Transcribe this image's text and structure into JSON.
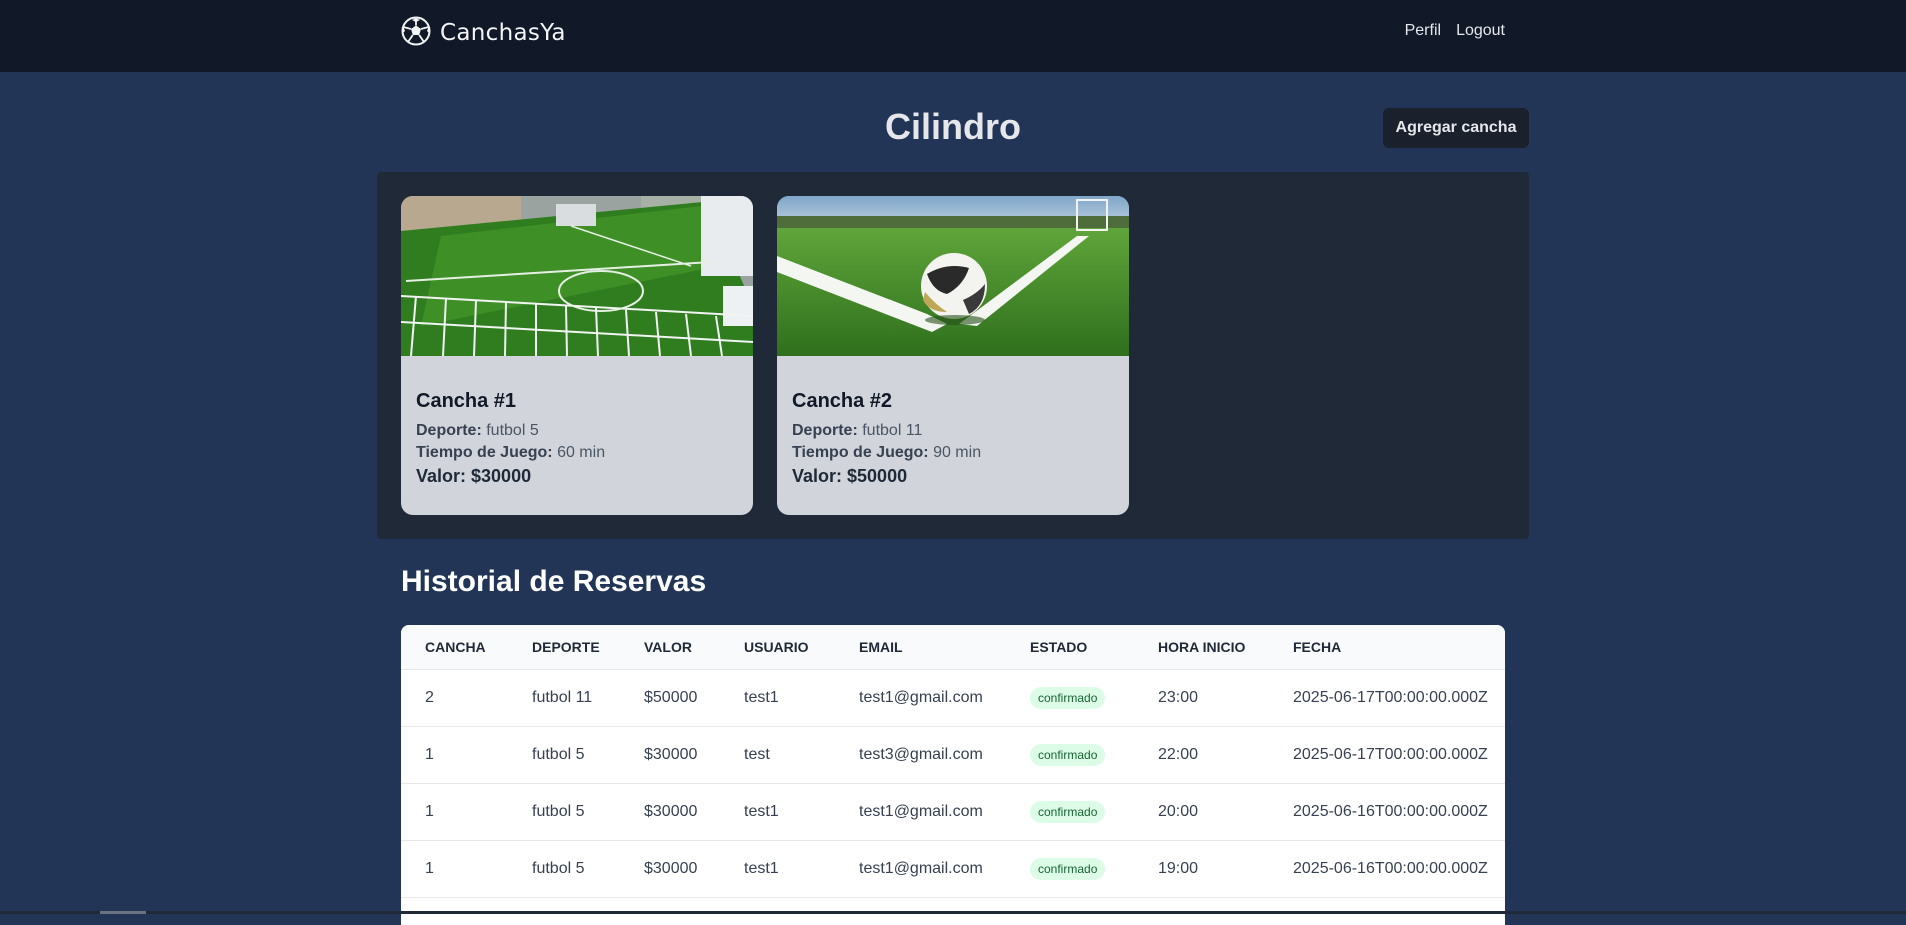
{
  "nav": {
    "brand": "CanchasYa",
    "links": [
      "Perfil",
      "Logout"
    ]
  },
  "header": {
    "title": "Cilindro",
    "add_button": "Agregar cancha"
  },
  "courts": [
    {
      "title": "Cancha #1",
      "deporte_label": "Deporte:",
      "deporte": "futbol 5",
      "tiempo_label": "Tiempo de Juego:",
      "tiempo": "60 min",
      "valor": "Valor: $30000"
    },
    {
      "title": "Cancha #2",
      "deporte_label": "Deporte:",
      "deporte": "futbol 11",
      "tiempo_label": "Tiempo de Juego:",
      "tiempo": "90 min",
      "valor": "Valor: $50000"
    }
  ],
  "history": {
    "title": "Historial de Reservas",
    "columns": [
      "Cancha",
      "Deporte",
      "Valor",
      "Usuario",
      "Email",
      "Estado",
      "Hora inicio",
      "Fecha"
    ],
    "rows": [
      [
        "2",
        "futbol 11",
        "$50000",
        "test1",
        "test1@gmail.com",
        "confirmado",
        "23:00",
        "2025-06-17T00:00:00.000Z"
      ],
      [
        "1",
        "futbol 5",
        "$30000",
        "test",
        "test3@gmail.com",
        "confirmado",
        "22:00",
        "2025-06-17T00:00:00.000Z"
      ],
      [
        "1",
        "futbol 5",
        "$30000",
        "test1",
        "test1@gmail.com",
        "confirmado",
        "20:00",
        "2025-06-16T00:00:00.000Z"
      ],
      [
        "1",
        "futbol 5",
        "$30000",
        "test1",
        "test1@gmail.com",
        "confirmado",
        "19:00",
        "2025-06-16T00:00:00.000Z"
      ]
    ]
  },
  "colors": {
    "navbar": "#111827",
    "page_bg": "#233557",
    "panel_bg": "#1f2937",
    "card_bg": "#d1d5db",
    "badge_bg": "#dcfce7",
    "badge_text": "#166534"
  },
  "icons": {
    "brand": "soccer-ball-icon"
  }
}
